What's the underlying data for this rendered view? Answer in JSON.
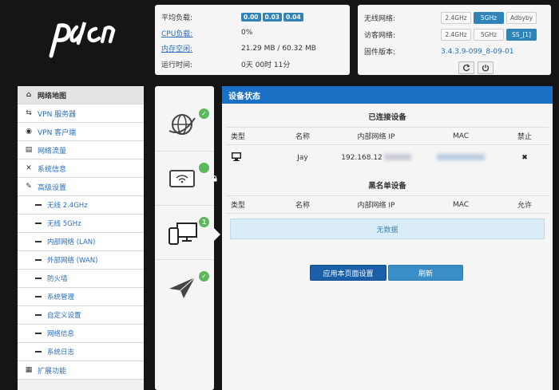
{
  "brand": {
    "logo_alt": "pdcn"
  },
  "stats": {
    "load": {
      "label": "平均负载:",
      "values": [
        "0.00",
        "0.03",
        "0.04"
      ]
    },
    "cpu": {
      "label": "CPU负载:",
      "value": "0%"
    },
    "mem": {
      "label": "内存空闲:",
      "value": "21.29 MB / 60.32 MB"
    },
    "uptime": {
      "label": "运行时间:",
      "value": "0天 00时 11分"
    }
  },
  "network": {
    "wireless": {
      "label": "无线网络:",
      "options": [
        "2.4GHz",
        "5GHz",
        "Adbyby"
      ],
      "active": "5GHz"
    },
    "guest": {
      "label": "访客网络:",
      "options": [
        "2.4GHz",
        "5GHz",
        "SS_[1]"
      ],
      "active": "SS_[1]"
    },
    "firmware": {
      "label": "固件版本:",
      "value": "3.4.3.9-099_8-09-01"
    },
    "icons": [
      "refresh-icon",
      "power-icon"
    ]
  },
  "sidebar": {
    "items": [
      {
        "label": "网络地图",
        "icon": "⌂",
        "type": "head"
      },
      {
        "label": "VPN 服务器",
        "icon": "⇆",
        "type": "item"
      },
      {
        "label": "VPN 客户端",
        "icon": "◉",
        "type": "item"
      },
      {
        "label": "网络流量",
        "icon": "▤",
        "type": "item"
      },
      {
        "label": "系统信息",
        "icon": "✕",
        "type": "item"
      },
      {
        "label": "高级设置",
        "icon": "✎",
        "type": "item"
      },
      {
        "label": "无线 2.4GHz",
        "type": "sub"
      },
      {
        "label": "无线 5GHz",
        "type": "sub"
      },
      {
        "label": "内部网络 (LAN)",
        "type": "sub"
      },
      {
        "label": "外部网络 (WAN)",
        "type": "sub"
      },
      {
        "label": "防火墙",
        "type": "sub"
      },
      {
        "label": "系统管理",
        "type": "sub"
      },
      {
        "label": "自定义设置",
        "type": "sub"
      },
      {
        "label": "网络信息",
        "type": "sub"
      },
      {
        "label": "系统日志",
        "type": "sub"
      },
      {
        "label": "扩展功能",
        "icon": "▦",
        "type": "item"
      }
    ]
  },
  "steps": [
    {
      "icon": "globe-icon",
      "status": "✓"
    },
    {
      "icon": "tablet-icon",
      "status": "🔒"
    },
    {
      "icon": "devices-icon",
      "status": "1"
    },
    {
      "icon": "plane-icon",
      "status": "✓"
    }
  ],
  "main": {
    "title": "设备状态",
    "connected": {
      "heading": "已连接设备",
      "columns": [
        "类型",
        "名称",
        "内部网络 IP",
        "MAC",
        "禁止"
      ],
      "rows": [
        {
          "name": "Jay",
          "ip": "192.168.12",
          "mac": "",
          "action": "✖"
        }
      ]
    },
    "blacklist": {
      "heading": "黑名单设备",
      "columns": [
        "类型",
        "名称",
        "内部网络 IP",
        "MAC",
        "允许"
      ],
      "empty": "无数据"
    },
    "buttons": {
      "apply": "应用本页面设置",
      "refresh": "刷新"
    }
  },
  "colors": {
    "accent": "#1b6fc4",
    "badge": "#2f83b7",
    "success": "#5cb85c",
    "background": "#151515"
  }
}
